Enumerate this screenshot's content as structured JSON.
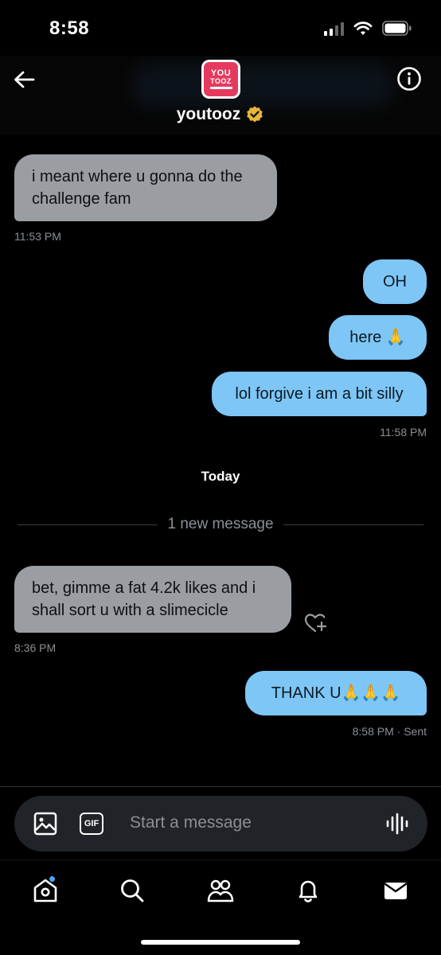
{
  "status_bar": {
    "time": "8:58"
  },
  "header": {
    "avatar_text_1": "YOU",
    "avatar_text_2": "TOOZ",
    "name": "youtooz"
  },
  "messages": [
    {
      "text": "i meant where u gonna do the challenge fam",
      "time": "11:53 PM"
    },
    {
      "text": "OH"
    },
    {
      "text": "here 🙏"
    },
    {
      "text": "lol forgive i am a bit silly",
      "time": "11:58 PM"
    },
    {
      "text": "bet, gimme a fat 4.2k likes and i shall sort u with a slimecicle",
      "time": "8:36 PM"
    },
    {
      "text": "THANK U🙏🙏🙏",
      "time": "8:58 PM",
      "status": "· Sent"
    }
  ],
  "separators": {
    "today": "Today",
    "new_message": "1 new message"
  },
  "composer": {
    "gif_label": "GIF",
    "placeholder": "Start a message"
  },
  "colors": {
    "incoming_bubble": "#9a9ea3",
    "outgoing_bubble": "#7dc6f6",
    "verified_badge": "#e8b739",
    "notification_dot": "#4aa6ff"
  },
  "nav": {
    "icons": [
      "home-icon",
      "search-icon",
      "communities-icon",
      "notifications-icon",
      "messages-icon"
    ]
  }
}
